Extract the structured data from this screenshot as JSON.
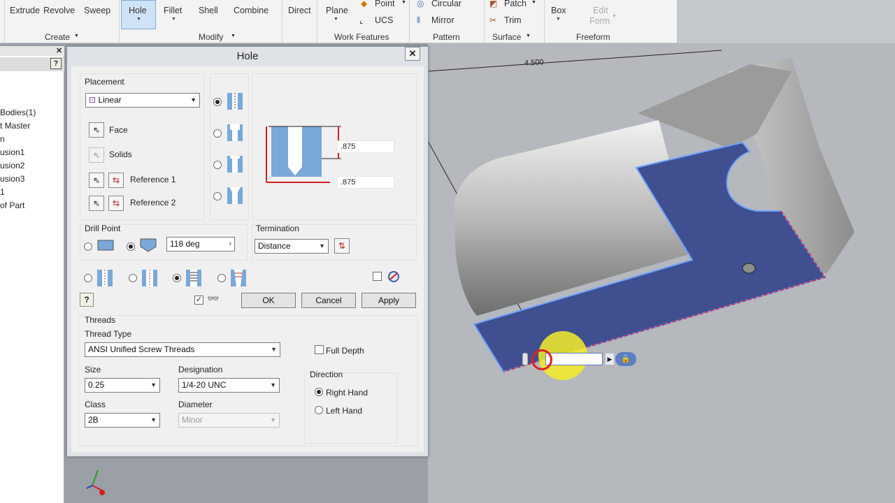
{
  "ribbon": {
    "buttons": {
      "extrude": "Extrude",
      "revolve": "Revolve",
      "sweep": "Sweep",
      "hole": "Hole",
      "fillet": "Fillet",
      "shell": "Shell",
      "combine": "Combine",
      "direct": "Direct",
      "plane": "Plane",
      "point": "Point",
      "ucs": "UCS",
      "circular": "Circular",
      "mirror": "Mirror",
      "patch": "Patch",
      "trim": "Trim",
      "box": "Box",
      "edit_form_line1": "Edit",
      "edit_form_line2": "Form"
    },
    "panels": {
      "create": "Create",
      "modify": "Modify",
      "work_features": "Work Features",
      "pattern": "Pattern",
      "surface": "Surface",
      "freeform": "Freeform"
    }
  },
  "browser": {
    "items": [
      "Bodies(1)",
      "t Master",
      "n",
      "usion1",
      "usion2",
      "usion3",
      "1",
      "of Part"
    ]
  },
  "viewport": {
    "dimension_label": "4.500"
  },
  "dialog": {
    "title": "Hole",
    "close": "✕",
    "placement": {
      "label": "Placement",
      "type": "Linear",
      "face": "Face",
      "solids": "Solids",
      "reference1": "Reference 1",
      "reference2": "Reference 2"
    },
    "preview": {
      "dim_top": ".875",
      "dim_bottom": ".875"
    },
    "drill_point": {
      "label": "Drill Point",
      "angle": "118 deg"
    },
    "termination": {
      "label": "Termination",
      "value": "Distance"
    },
    "buttons": {
      "ok": "OK",
      "cancel": "Cancel",
      "apply": "Apply",
      "help": "?"
    },
    "threads": {
      "label": "Threads",
      "thread_type_label": "Thread Type",
      "thread_type": "ANSI Unified Screw Threads",
      "full_depth": "Full Depth",
      "size_label": "Size",
      "size": "0.25",
      "designation_label": "Designation",
      "designation": "1/4-20 UNC",
      "class_label": "Class",
      "class": "2B",
      "diameter_label": "Diameter",
      "diameter": "Minor",
      "direction_label": "Direction",
      "right_hand": "Right Hand",
      "left_hand": "Left Hand"
    }
  },
  "colors": {
    "face_blue": "#3f4f8f",
    "highlight": "#5b8cff",
    "ribbon_bg": "#f3f3f3",
    "dialog_bg": "#f0f0f0"
  }
}
